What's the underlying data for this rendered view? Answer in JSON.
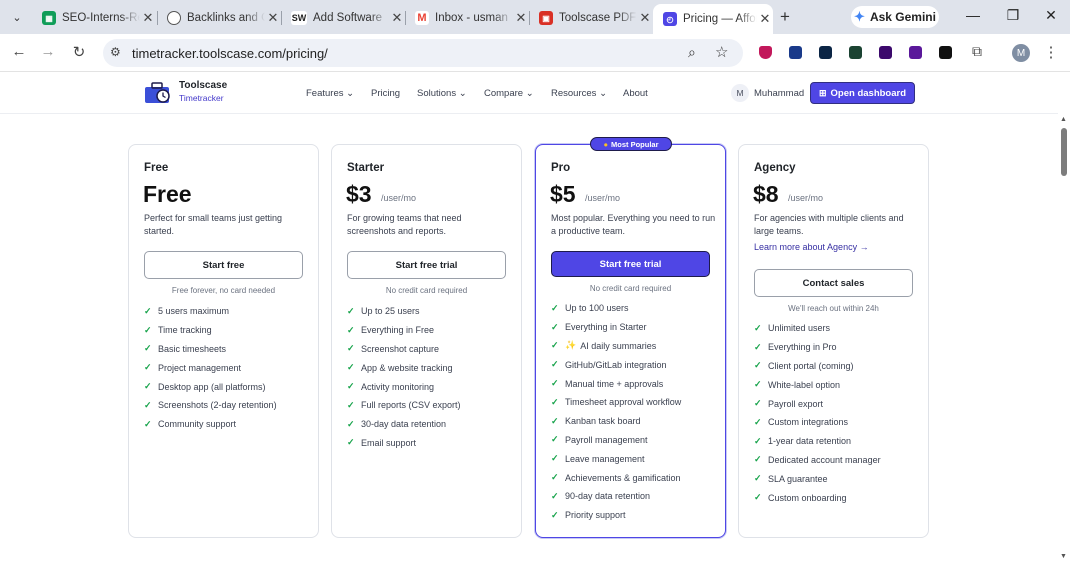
{
  "browser": {
    "tabs": [
      {
        "title": "SEO-Interns-Report",
        "icon": "sheets-icon",
        "color": "#0f9d58"
      },
      {
        "title": "Backlinks and Guest Posts",
        "icon": "globe-icon",
        "color": "#555555"
      },
      {
        "title": "Add Software",
        "icon": "sw-icon",
        "color": "#222222",
        "icon_text": "SW"
      },
      {
        "title": "Inbox - usman",
        "icon": "gmail-icon",
        "color": "#ea4335"
      },
      {
        "title": "Toolscase PDF",
        "icon": "pdf-icon",
        "color": "#d93025"
      },
      {
        "title": "Pricing — Affordable Time Tracking",
        "icon": "toolscase-icon",
        "color": "#4f46e5",
        "active": true
      }
    ],
    "gemini_label": "Ask Gemini",
    "url": "timetracker.toolscase.com/pricing/",
    "profile_initial": "M"
  },
  "site": {
    "brand": "Toolscase",
    "brand_sub": "Timetracker",
    "nav": [
      {
        "label": "Features",
        "dropdown": true
      },
      {
        "label": "Pricing",
        "dropdown": false
      },
      {
        "label": "Solutions",
        "dropdown": true
      },
      {
        "label": "Compare",
        "dropdown": true
      },
      {
        "label": "Resources",
        "dropdown": true
      },
      {
        "label": "About",
        "dropdown": false
      }
    ],
    "user_initial": "M",
    "user_name": "Muhammad",
    "dashboard_label": "Open dashboard",
    "accent_color": "#4f46e5"
  },
  "plans": [
    {
      "name": "Free",
      "price": "Free",
      "per": "",
      "description": "Perfect for small teams just getting started.",
      "cta": "Start free",
      "note": "Free forever, no card needed",
      "features": [
        "5 users maximum",
        "Time tracking",
        "Basic timesheets",
        "Project management",
        "Desktop app (all platforms)",
        "Screenshots (2-day retention)",
        "Community support"
      ]
    },
    {
      "name": "Starter",
      "price": "$3",
      "per": "/user/mo",
      "description": "For growing teams that need screenshots and reports.",
      "cta": "Start free trial",
      "note": "No credit card required",
      "features": [
        "Up to 25 users",
        "Everything in Free",
        "Screenshot capture",
        "App & website tracking",
        "Activity monitoring",
        "Full reports (CSV export)",
        "30-day data retention",
        "Email support"
      ]
    },
    {
      "name": "Pro",
      "price": "$5",
      "per": "/user/mo",
      "badge": "Most Popular",
      "description": "Most popular. Everything you need to run a productive team.",
      "cta": "Start free trial",
      "note": "No credit card required",
      "features": [
        "Up to 100 users",
        "Everything in Starter",
        "AI daily summaries",
        "GitHub/GitLab integration",
        "Manual time + approvals",
        "Timesheet approval workflow",
        "Kanban task board",
        "Payroll management",
        "Leave management",
        "Achievements & gamification",
        "90-day data retention",
        "Priority support"
      ]
    },
    {
      "name": "Agency",
      "price": "$8",
      "per": "/user/mo",
      "description": "For agencies with multiple clients and large teams.",
      "learn_more": "Learn more about Agency →",
      "cta": "Contact sales",
      "note": "We'll reach out within 24h",
      "features": [
        "Unlimited users",
        "Everything in Pro",
        "Client portal (coming)",
        "White-label option",
        "Payroll export",
        "Custom integrations",
        "1-year data retention",
        "Dedicated account manager",
        "SLA guarantee",
        "Custom onboarding"
      ]
    }
  ]
}
